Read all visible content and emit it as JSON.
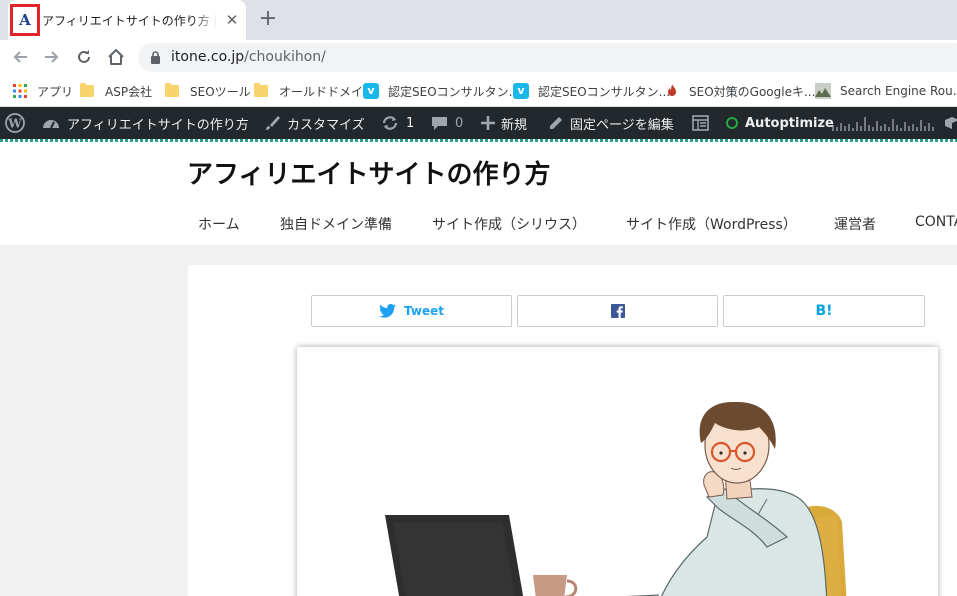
{
  "browser": {
    "tab": {
      "favicon_letter": "A",
      "title": "アフィリエイトサイトの作り方｜稼げるサイト"
    },
    "url": {
      "host": "itone.co.jp",
      "path": "/choukihon/"
    }
  },
  "bookmarks": [
    {
      "label": "アプリ",
      "icon": "apps-grid-icon"
    },
    {
      "label": "ASP会社",
      "icon": "folder-icon"
    },
    {
      "label": "SEOツール",
      "icon": "folder-icon"
    },
    {
      "label": "オールドドメイン",
      "icon": "folder-icon"
    },
    {
      "label": "認定SEOコンサルタン...",
      "icon": "vimeo-icon"
    },
    {
      "label": "認定SEOコンサルタン...",
      "icon": "vimeo-icon"
    },
    {
      "label": "SEO対策のGoogleキ...",
      "icon": "flame-icon"
    },
    {
      "label": "Search Engine Rou...",
      "icon": "landscape-icon"
    }
  ],
  "wp_admin_bar": {
    "site_name": "アフィリエイトサイトの作り方",
    "customize": "カスタマイズ",
    "updates_count": "1",
    "comments_count": "0",
    "new": "新規",
    "edit_page": "固定ページを編集",
    "autoptimize": "Autoptimize",
    "autoptimize_status_color": "#28a745"
  },
  "site": {
    "title": "アフィリエイトサイトの作り方",
    "nav": [
      "ホーム",
      "独自ドメイン準備",
      "サイト作成（シリウス）",
      "サイト作成（WordPress）",
      "運営者",
      "CONTA"
    ]
  },
  "share": {
    "tweet": "Tweet",
    "hatena": "B!",
    "twitter_color": "#1da1f2",
    "facebook_color": "#3b5998",
    "hatena_color": "#00a4de"
  }
}
